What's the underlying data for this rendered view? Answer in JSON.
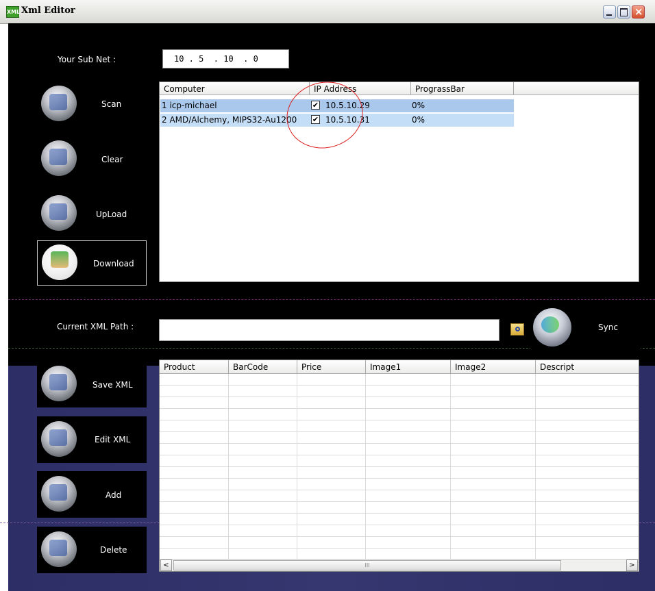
{
  "window": {
    "title": "Xml Editor",
    "icon_text": "XML"
  },
  "subnet": {
    "label": "Your Sub Net :",
    "value": "10 . 5  . 10  . 0"
  },
  "buttons": {
    "scan": "Scan",
    "clear": "Clear",
    "upload": "UpLoad",
    "download": "Download",
    "sync": "Sync",
    "save_xml": "Save XML",
    "edit_xml": "Edit XML",
    "add": "Add",
    "delete": "Delete"
  },
  "device_list": {
    "columns": [
      "Computer",
      "IP Address",
      "PrograssBar"
    ],
    "rows": [
      {
        "computer": "1 icp-michael",
        "checked": true,
        "ip": "10.5.10.29",
        "progress": "0%"
      },
      {
        "computer": "2 AMD/Alchemy, MIPS32-Au1200",
        "checked": true,
        "ip": "10.5.10.31",
        "progress": "0%"
      }
    ]
  },
  "xml_path": {
    "label": "Current XML Path :",
    "value": ""
  },
  "product_grid": {
    "columns": [
      "Product",
      "BarCode",
      "Price",
      "Image1",
      "Image2",
      "Descript"
    ]
  },
  "colors": {
    "row_selected": "#a9c8ec",
    "row_alt": "#c4def7",
    "annotation": "#dd2222",
    "lower_panel": "#33336c"
  },
  "icons": {
    "check": "✔",
    "scroll_left": "<",
    "scroll_right": ">",
    "thumb_grip": "III"
  }
}
